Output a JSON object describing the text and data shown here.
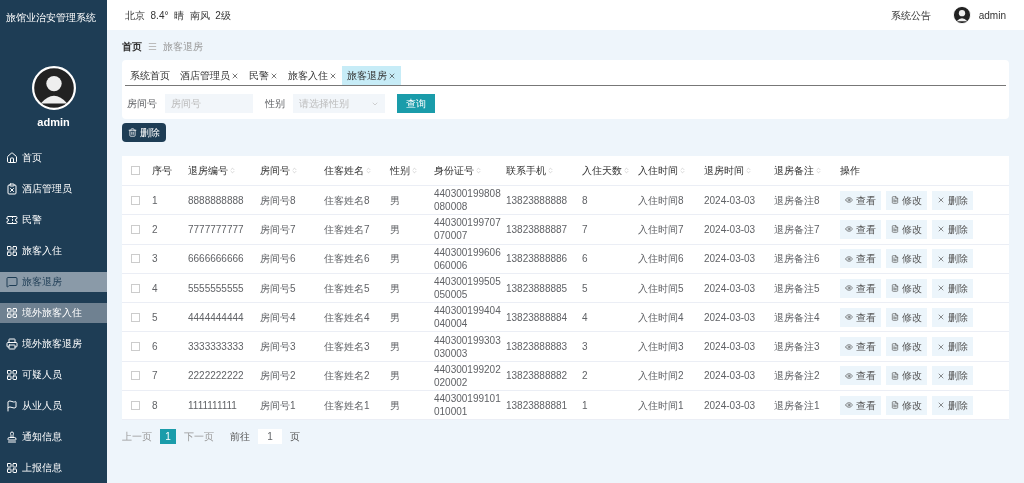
{
  "app_title": "旅馆业治安管理系统",
  "user": {
    "name": "admin"
  },
  "weather": "北京  8.4°  晴  南风  2级",
  "top_bar": {
    "notice": "系统公告",
    "user": "admin"
  },
  "sidebar": {
    "items": [
      {
        "label": "首页",
        "selected": false,
        "hovered": false
      },
      {
        "label": "酒店管理员",
        "selected": false,
        "hovered": false
      },
      {
        "label": "民警",
        "selected": false,
        "hovered": false
      },
      {
        "label": "旅客入住",
        "selected": false,
        "hovered": false
      },
      {
        "label": "旅客退房",
        "selected": true,
        "hovered": false
      },
      {
        "label": "境外旅客入住",
        "selected": false,
        "hovered": true
      },
      {
        "label": "境外旅客退房",
        "selected": false,
        "hovered": false
      },
      {
        "label": "可疑人员",
        "selected": false,
        "hovered": false
      },
      {
        "label": "从业人员",
        "selected": false,
        "hovered": false
      },
      {
        "label": "通知信息",
        "selected": false,
        "hovered": false
      },
      {
        "label": "上报信息",
        "selected": false,
        "hovered": false
      }
    ]
  },
  "breadcrumb": {
    "home": "首页",
    "separator": "☰",
    "current": "旅客退房"
  },
  "tabs": [
    {
      "label": "系统首页",
      "closable": false,
      "selected": false
    },
    {
      "label": "酒店管理员",
      "closable": true,
      "selected": false
    },
    {
      "label": "民警",
      "closable": true,
      "selected": false
    },
    {
      "label": "旅客入住",
      "closable": true,
      "selected": false
    },
    {
      "label": "旅客退房",
      "closable": true,
      "selected": true
    }
  ],
  "search": {
    "room_label": "房间号",
    "room_placeholder": "房间号",
    "gender_label": "性别",
    "gender_placeholder": "请选择性别",
    "button": "查询"
  },
  "delete_button": "删除",
  "table": {
    "select_all_checked": false,
    "columns": [
      {
        "label": "序号",
        "sortable": false
      },
      {
        "label": "退房编号",
        "sortable": true
      },
      {
        "label": "房间号",
        "sortable": true
      },
      {
        "label": "住客姓名",
        "sortable": true
      },
      {
        "label": "性别",
        "sortable": true
      },
      {
        "label": "身份证号",
        "sortable": true
      },
      {
        "label": "联系手机",
        "sortable": true
      },
      {
        "label": "入住天数",
        "sortable": true
      },
      {
        "label": "入住时间",
        "sortable": true
      },
      {
        "label": "退房时间",
        "sortable": true
      },
      {
        "label": "退房备注",
        "sortable": true
      },
      {
        "label": "操作",
        "sortable": false
      }
    ],
    "rows": [
      {
        "checked": false,
        "cells": [
          "1",
          "8888888888",
          "房间号8",
          "住客姓名8",
          "男",
          "440300199808\n080008",
          "13823888888",
          "8",
          "入住时间8",
          "2024-03-03",
          "退房备注8"
        ],
        "actions": [
          "查看",
          "修改",
          "删除"
        ]
      },
      {
        "checked": false,
        "cells": [
          "2",
          "7777777777",
          "房间号7",
          "住客姓名7",
          "男",
          "440300199707\n070007",
          "13823888887",
          "7",
          "入住时间7",
          "2024-03-03",
          "退房备注7"
        ],
        "actions": [
          "查看",
          "修改",
          "删除"
        ]
      },
      {
        "checked": false,
        "cells": [
          "3",
          "6666666666",
          "房间号6",
          "住客姓名6",
          "男",
          "440300199606\n060006",
          "13823888886",
          "6",
          "入住时间6",
          "2024-03-03",
          "退房备注6"
        ],
        "actions": [
          "查看",
          "修改",
          "删除"
        ]
      },
      {
        "checked": false,
        "cells": [
          "4",
          "5555555555",
          "房间号5",
          "住客姓名5",
          "男",
          "440300199505\n050005",
          "13823888885",
          "5",
          "入住时间5",
          "2024-03-03",
          "退房备注5"
        ],
        "actions": [
          "查看",
          "修改",
          "删除"
        ]
      },
      {
        "checked": false,
        "cells": [
          "5",
          "4444444444",
          "房间号4",
          "住客姓名4",
          "男",
          "440300199404\n040004",
          "13823888884",
          "4",
          "入住时间4",
          "2024-03-03",
          "退房备注4"
        ],
        "actions": [
          "查看",
          "修改",
          "删除"
        ]
      },
      {
        "checked": false,
        "cells": [
          "6",
          "3333333333",
          "房间号3",
          "住客姓名3",
          "男",
          "440300199303\n030003",
          "13823888883",
          "3",
          "入住时间3",
          "2024-03-03",
          "退房备注3"
        ],
        "actions": [
          "查看",
          "修改",
          "删除"
        ]
      },
      {
        "checked": false,
        "cells": [
          "7",
          "2222222222",
          "房间号2",
          "住客姓名2",
          "男",
          "440300199202\n020002",
          "13823888882",
          "2",
          "入住时间2",
          "2024-03-03",
          "退房备注2"
        ],
        "actions": [
          "查看",
          "修改",
          "删除"
        ]
      },
      {
        "checked": false,
        "cells": [
          "8",
          "1111111111",
          "房间号1",
          "住客姓名1",
          "男",
          "440300199101\n010001",
          "13823888881",
          "1",
          "入住时间1",
          "2024-03-03",
          "退房备注1"
        ],
        "actions": [
          "查看",
          "修改",
          "删除"
        ]
      }
    ]
  },
  "pagination": {
    "prev": "上一页",
    "pages": [
      {
        "label": "1",
        "selected": true
      }
    ],
    "next": "下一页",
    "goto_label": "前往",
    "goto_value": "1",
    "goto_suffix": "页"
  }
}
